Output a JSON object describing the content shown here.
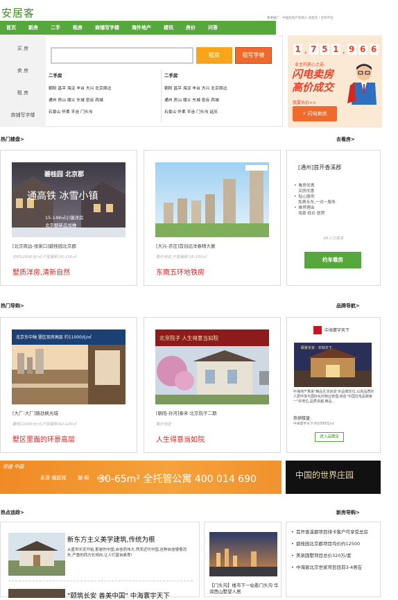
{
  "header": {
    "logo": "安居客",
    "top_note": "我要推广 · 中国房地产资源人 房屋店 / 合作平台"
  },
  "nav": [
    "首页",
    "新房",
    "二手",
    "租房",
    "商铺写字楼",
    "海外地产",
    "楼讯",
    "房价",
    "问答"
  ],
  "search": {
    "side_tabs": [
      "买 房",
      "卖 房",
      "租 房",
      "商铺写字楼"
    ],
    "input_placeholder": "",
    "btn_rent": "租房",
    "btn_office": "租写字楼",
    "columns": [
      {
        "title": "二手房",
        "rows": [
          "朝阳  昌平  海淀  丰台  大兴  北京周边",
          "通州  房山  顺义  东城  密云  西城",
          "石景山  怀柔  平谷  门头沟"
        ]
      },
      {
        "title": "二手房",
        "rows": [
          "朝阳  昌平  海淀  丰台  大兴  北京周边",
          "通州  房山  顺义  东城  密云  西城",
          "石景山  怀柔  平谷  门头沟  延庆"
        ]
      }
    ]
  },
  "sell_ad": {
    "digits": [
      "1",
      "7",
      "5",
      "1",
      "9",
      "6",
      "6"
    ],
    "sub": "业主的放心之选",
    "big_1": "闪电卖房",
    "big_2": "高价成交",
    "question": "我要估价>>",
    "button": "闪电卖房"
  },
  "hot_buildings": {
    "title": "热门楼盘>",
    "more": "去看房>",
    "cards": [
      {
        "img_brand": "碧桂园 北京郡",
        "img_tag": "通高铁 冰雪小镇",
        "img_small": "15-148㎡小镇洋房",
        "img_small2": "北京郡新品加推",
        "name": "[北京周边-张家口]碧桂园北京郡",
        "price": "均价12500元/㎡,户型面积:35-150㎡",
        "slogan": "墅质洋房,清新自然"
      },
      {
        "name": "[大兴-亦庄]首创远洋春晴大著",
        "price": "售价待定,户型面积:35-150㎡",
        "slogan": "东南五环地铁房"
      }
    ],
    "promo": {
      "title": "[通州]首开香溪郡",
      "items": [
        "看房优惠",
        "买房优惠",
        "贴心服务",
        "免费专车,一对一服务",
        "推荐理由",
        "海景  低价  医院"
      ],
      "count": "48人已报名",
      "button": "约车看房"
    }
  },
  "hot_guide": {
    "title": "热门导购>",
    "more": "品牌导航>",
    "cards": [
      {
        "img_top": "北京东中轴  暨区现房高层  约11000元/㎡",
        "name": "[大厂-大厂]路劲枫光城",
        "price": "最低11000元/㎡,户型面积:62-120㎡",
        "slogan": "墅区里面的环景高层"
      },
      {
        "img_top": "北京院子  人生得意当如院",
        "name": "[朝阳-孙河]泰禾·北京院子二期",
        "price": "售价待定",
        "slogan": "人生得意当如院"
      }
    ],
    "brand": {
      "logo_text": "中海寰宇天下",
      "img_text": "颐景长安 · 衣钵天下",
      "desc": "中海地产秉承\"精品生活创造\"的品牌定位,以高品质的人居环境与国际化的物业管理,缔造\"中国住宅品牌第一\"的地位,品质卓越,精品...",
      "hot": "热销楼盘:",
      "hot_sub": "中海寰宇天下:约1000元/㎡",
      "button": "进入品牌店"
    }
  },
  "banners": {
    "left_brand": "荣盛 中国",
    "left_item1": "永清·瀚庭城",
    "left_item2": "瀚·阁",
    "left_item3": "建面约",
    "left_text": "30-65m² 全托管公寓 400 014 690",
    "right_text": "中国的世界庄园"
  },
  "hot_news": {
    "title": "热点追踪>",
    "more": "新房导购>",
    "items": [
      {
        "title": "新东方主义美学建筑,传统为根",
        "desc": "从盛世长安开始,那是的中国,自信而伟大,然而近代中国,这种自信慢慢消失,严重的西方化倾向,让人们曾自素卑!"
      },
      {
        "title": "\"颐筑长安 善美中国\" 中海寰宇天下"
      }
    ],
    "mid": {
      "text": "【门头沟】楼市下一站看门头沟 华润西山墅望人居"
    },
    "list": [
      "首开香溪郡项目排卡客户可享受总房",
      "碧桂园北京郡项目均价约12500",
      "美泉圆墅项目总价320万/套",
      "中海宸北京世家项目目前3-4居在"
    ]
  }
}
